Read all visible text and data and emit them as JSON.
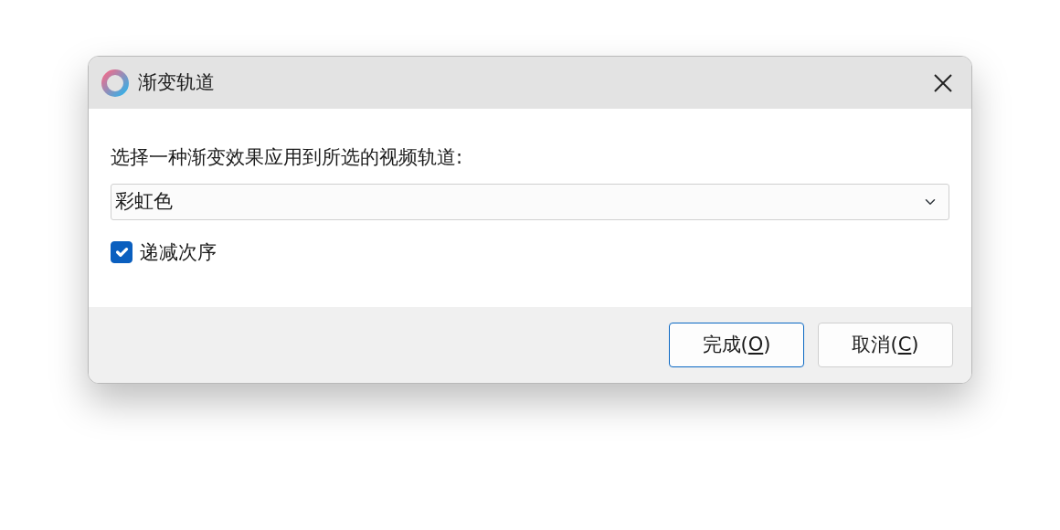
{
  "window": {
    "title": "渐变轨道"
  },
  "prompt": "选择一种渐变效果应用到所选的视频轨道:",
  "dropdown": {
    "value": "彩虹色"
  },
  "checkbox": {
    "label": "递减次序",
    "checked": true
  },
  "buttons": [
    {
      "label_before": "完成(",
      "access_key": "O",
      "label_after": ")",
      "default": true
    },
    {
      "label_before": "取消(",
      "access_key": "C",
      "label_after": ")",
      "default": false
    }
  ]
}
